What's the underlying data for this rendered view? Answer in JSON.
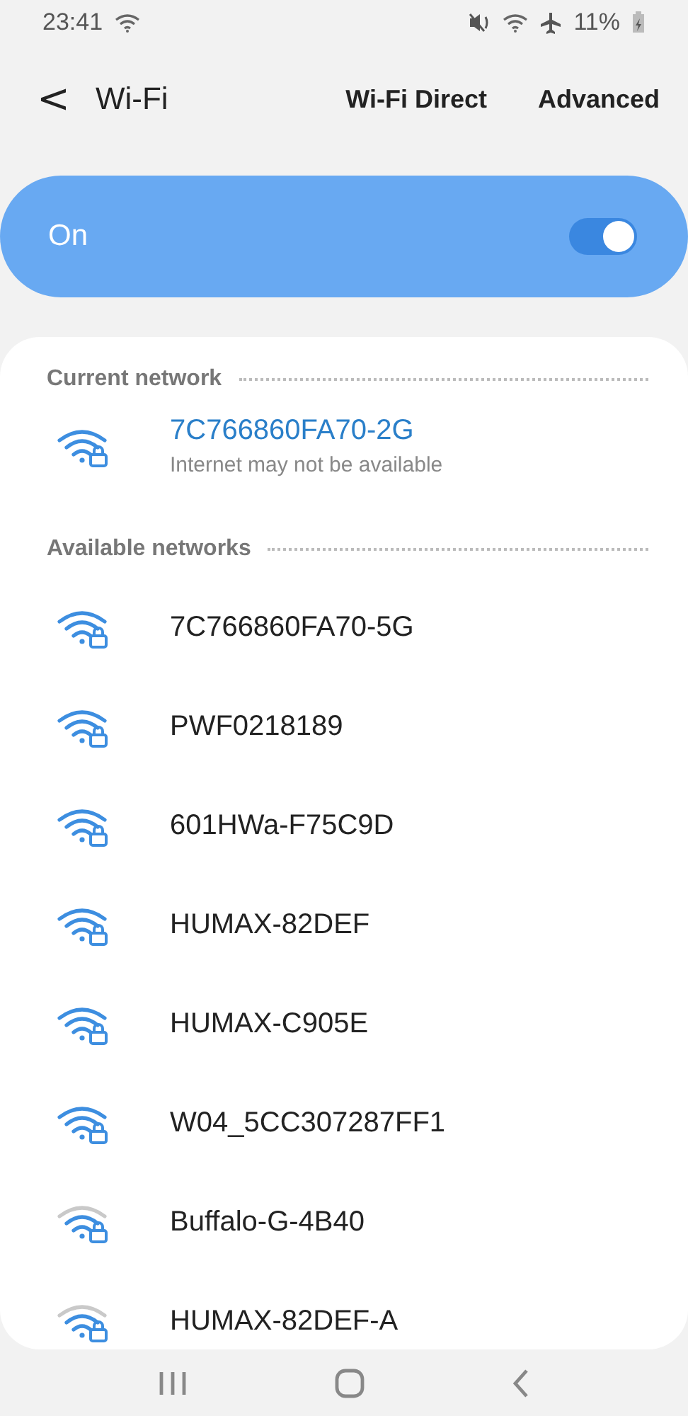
{
  "status_bar": {
    "time": "23:41",
    "battery": "11%"
  },
  "header": {
    "back": "<",
    "title": "Wi-Fi",
    "actions": [
      "Wi-Fi Direct",
      "Advanced"
    ]
  },
  "master_switch": {
    "label": "On",
    "on": true
  },
  "current_network": {
    "heading": "Current network",
    "name": "7C766860FA70-2G",
    "status": "Internet may not be available",
    "weak_signal": false,
    "locked": true
  },
  "available_networks": {
    "heading": "Available networks",
    "items": [
      {
        "name": "7C766860FA70-5G",
        "weak_signal": false,
        "locked": true
      },
      {
        "name": "PWF0218189",
        "weak_signal": false,
        "locked": true
      },
      {
        "name": "601HWa-F75C9D",
        "weak_signal": false,
        "locked": true
      },
      {
        "name": "HUMAX-82DEF",
        "weak_signal": false,
        "locked": true
      },
      {
        "name": "HUMAX-C905E",
        "weak_signal": false,
        "locked": true
      },
      {
        "name": "W04_5CC307287FF1",
        "weak_signal": false,
        "locked": true
      },
      {
        "name": "Buffalo-G-4B40",
        "weak_signal": true,
        "locked": true
      },
      {
        "name": "HUMAX-82DEF-A",
        "weak_signal": true,
        "locked": true
      }
    ]
  }
}
